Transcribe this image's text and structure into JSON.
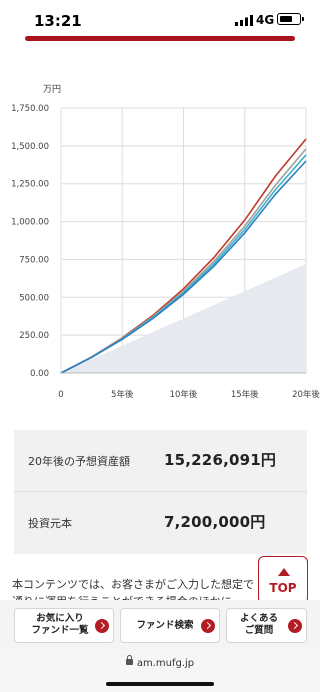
{
  "status_bar": {
    "time": "13:21",
    "network": "4G"
  },
  "chart_data": {
    "type": "line",
    "unit_label": "万円",
    "y_ticks": [
      "1,750.00",
      "1,500.00",
      "1,250.00",
      "1,000.00",
      "750.00",
      "500.00",
      "250.00",
      "0.00"
    ],
    "x_ticks": [
      "0",
      "5年後",
      "10年後",
      "15年後",
      "20年後"
    ],
    "ylim": [
      0,
      1750
    ],
    "xlim": [
      0,
      20
    ],
    "grid": true,
    "principal_area": {
      "x": [
        0,
        20
      ],
      "values": [
        0,
        720
      ]
    },
    "series": [
      {
        "color": "#c0392b",
        "values": [
          0,
          106,
          232,
          380,
          556,
          764,
          1010,
          1300,
          1545
        ]
      },
      {
        "color": "#a0a0a0",
        "values": [
          0,
          105,
          228,
          372,
          540,
          738,
          970,
          1240,
          1480
        ]
      },
      {
        "color": "#3bb3c9",
        "values": [
          0,
          104,
          225,
          366,
          530,
          722,
          947,
          1210,
          1440
        ]
      },
      {
        "color": "#2e7fc2",
        "values": [
          0,
          103,
          222,
          360,
          520,
          706,
          925,
          1180,
          1400
        ]
      }
    ],
    "x": [
      0,
      2.5,
      5,
      7.5,
      10,
      12.5,
      15,
      17.5,
      20
    ]
  },
  "summary": {
    "rows": [
      {
        "label": "20年後の予想資産額",
        "value": "15,226,091円"
      },
      {
        "label": "投資元本",
        "value": "7,200,000円"
      }
    ]
  },
  "notice": {
    "line1": "本コンテンツでは、お客さまがご入力した想定で",
    "line2": "通りに運用を行うことができる場合のほかに"
  },
  "top_button": {
    "label": "TOP"
  },
  "bottom_nav": {
    "favorites_line1": "お気に入り",
    "favorites_line2": "ファンド一覧",
    "search": "ファンド検索",
    "faq_line1": "よくある",
    "faq_line2": "ご質問"
  },
  "browser": {
    "url": "am.mufg.jp"
  },
  "colors": {
    "accent": "#b21c22",
    "grid": "#dddddd",
    "area": "#e6e9f0"
  }
}
